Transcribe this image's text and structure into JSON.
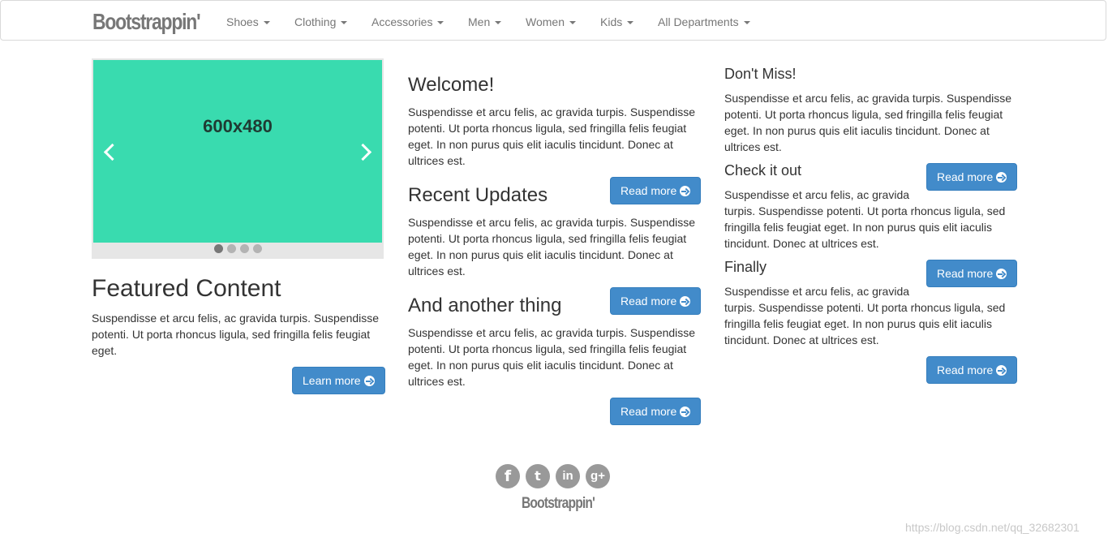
{
  "brand": "Bootstrappin'",
  "nav": {
    "items": [
      "Shoes",
      "Clothing",
      "Accessories",
      "Men",
      "Women",
      "Kids",
      "All Departments"
    ]
  },
  "carousel": {
    "slide_label": "600x480",
    "slide_color": "#39dbaf",
    "slide_count": 4,
    "active_index": 0
  },
  "featured": {
    "title": "Featured Content",
    "text": "Suspendisse et arcu felis, ac gravida turpis. Suspendisse potenti. Ut porta rhoncus ligula, sed fringilla felis feugiat eget.",
    "button": "Learn more"
  },
  "middle": [
    {
      "title": "Welcome!",
      "text": "Suspendisse et arcu felis, ac gravida turpis. Suspendisse potenti. Ut porta rhoncus ligula, sed fringilla felis feugiat eget. In non purus quis elit iaculis tincidunt. Donec at ultrices est.",
      "button": "Read more"
    },
    {
      "title": "Recent Updates",
      "text": "Suspendisse et arcu felis, ac gravida turpis. Suspendisse potenti. Ut porta rhoncus ligula, sed fringilla felis feugiat eget. In non purus quis elit iaculis tincidunt. Donec at ultrices est.",
      "button": "Read more"
    },
    {
      "title": "And another thing",
      "text": "Suspendisse et arcu felis, ac gravida turpis. Suspendisse potenti. Ut porta rhoncus ligula, sed fringilla felis feugiat eget. In non purus quis elit iaculis tincidunt. Donec at ultrices est.",
      "button": "Read more"
    }
  ],
  "right": [
    {
      "title": "Don't Miss!",
      "text": "Suspendisse et arcu felis, ac gravida turpis. Suspendisse potenti. Ut porta rhoncus ligula, sed fringilla felis feugiat eget. In non purus quis elit iaculis tincidunt. Donec at ultrices est.",
      "button": "Read more"
    },
    {
      "title": "Check it out",
      "text": "Suspendisse et arcu felis, ac gravida turpis. Suspendisse potenti. Ut porta rhoncus ligula, sed fringilla felis feugiat eget. In non purus quis elit iaculis tincidunt. Donec at ultrices est.",
      "button": "Read more"
    },
    {
      "title": "Finally",
      "text": "Suspendisse et arcu felis, ac gravida turpis. Suspendisse potenti. Ut porta rhoncus ligula, sed fringilla felis feugiat eget. In non purus quis elit iaculis tincidunt. Donec at ultrices est.",
      "button": "Read more"
    }
  ],
  "footer": {
    "social": [
      {
        "icon": "facebook-icon",
        "glyph": "f"
      },
      {
        "icon": "twitter-icon",
        "glyph": "t"
      },
      {
        "icon": "linkedin-icon",
        "glyph": "in"
      },
      {
        "icon": "google-plus-icon",
        "glyph": "g+"
      }
    ],
    "brand": "Bootstrappin'"
  },
  "watermark": "https://blog.csdn.net/qq_32682301",
  "colors": {
    "primary": "#428bca",
    "slide": "#39dbaf",
    "muted": "#777777"
  }
}
